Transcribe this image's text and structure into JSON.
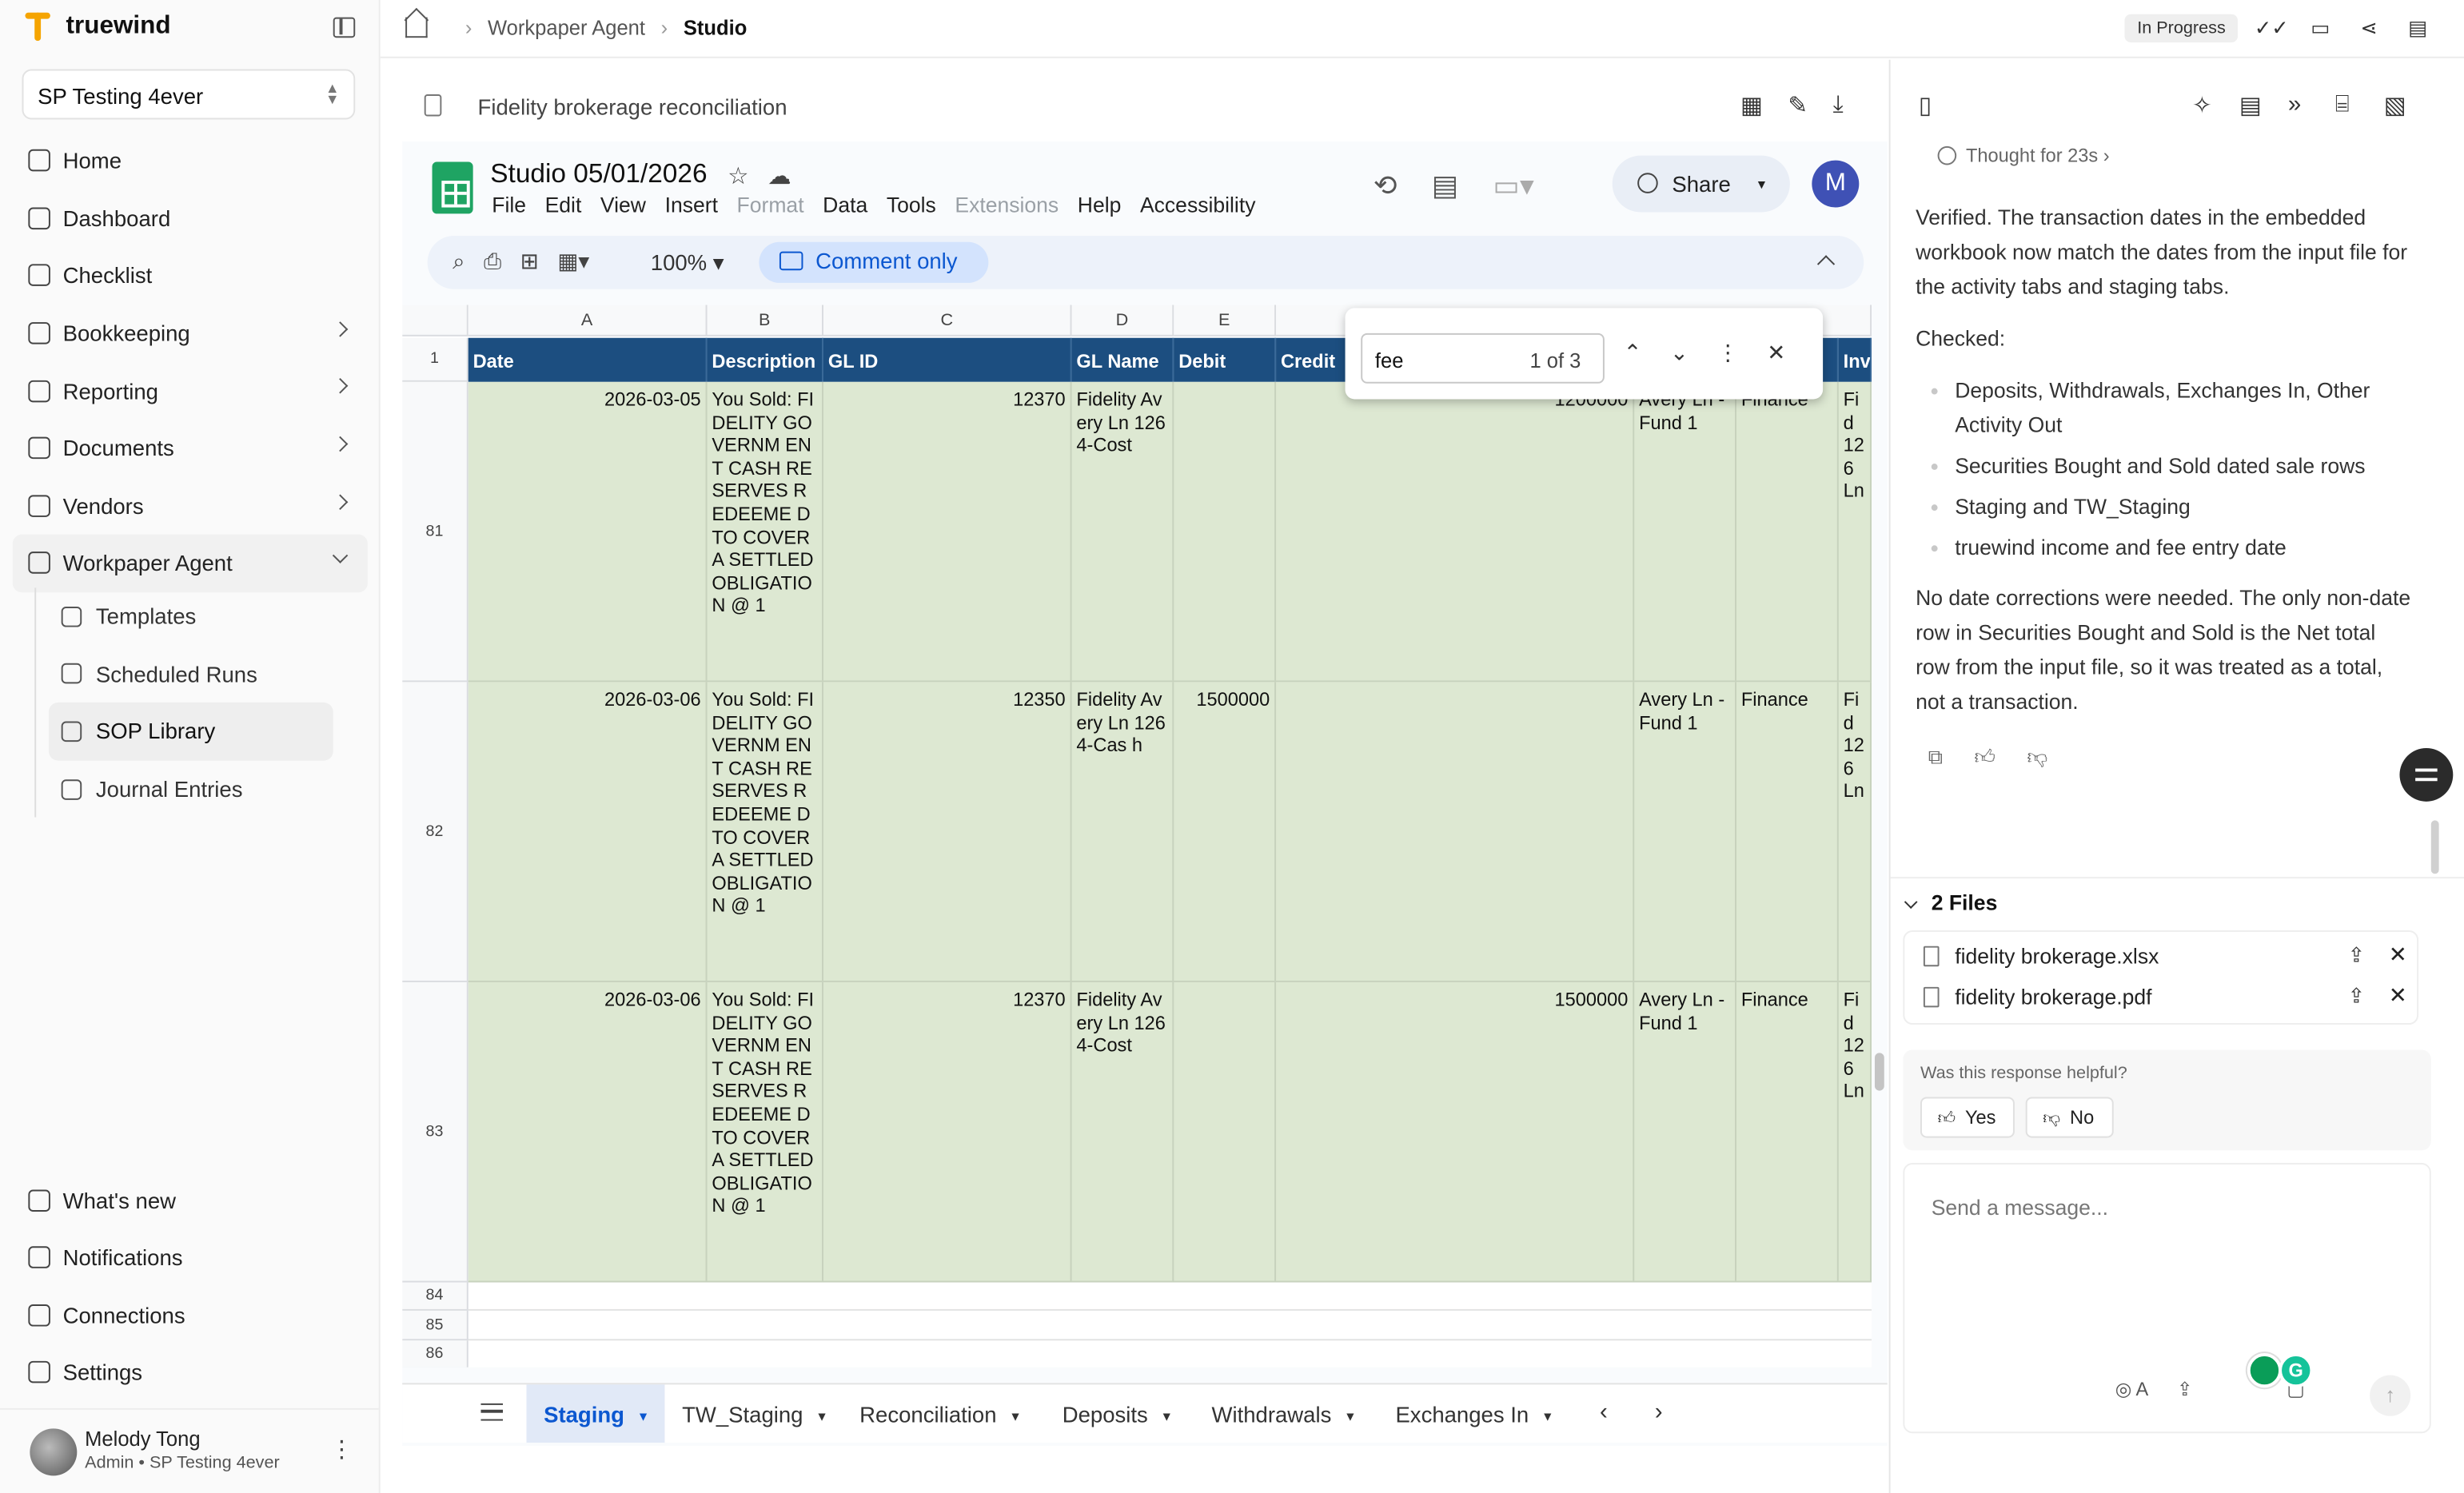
{
  "app": {
    "brand": "truewind",
    "org": "SP Testing 4ever"
  },
  "nav": {
    "items": [
      {
        "label": "Home",
        "icon": "home-icon"
      },
      {
        "label": "Dashboard",
        "icon": "dashboard-icon"
      },
      {
        "label": "Checklist",
        "icon": "calendar-icon"
      },
      {
        "label": "Bookkeeping",
        "icon": "book-icon"
      },
      {
        "label": "Reporting",
        "icon": "chart-icon"
      },
      {
        "label": "Documents",
        "icon": "copy-icon"
      },
      {
        "label": "Vendors",
        "icon": "card-icon"
      },
      {
        "label": "Workpaper Agent",
        "icon": "workflow-icon"
      }
    ],
    "sub_items": [
      {
        "label": "Templates",
        "icon": "template-icon"
      },
      {
        "label": "Scheduled Runs",
        "icon": "calendar-clock-icon"
      },
      {
        "label": "SOP Library",
        "icon": "library-icon"
      },
      {
        "label": "Journal Entries",
        "icon": "journal-icon"
      }
    ],
    "bottom": [
      {
        "label": "What's new",
        "icon": "gift-icon"
      },
      {
        "label": "Notifications",
        "icon": "bell-icon"
      },
      {
        "label": "Connections",
        "icon": "plug-icon"
      },
      {
        "label": "Settings",
        "icon": "gear-icon"
      }
    ]
  },
  "user": {
    "name": "Melody Tong",
    "role": "Admin • SP Testing 4ever"
  },
  "topbar": {
    "crumbs": [
      "Workpaper Agent",
      "Studio"
    ],
    "status": "In Progress"
  },
  "doc": {
    "title": "Fidelity brokerage reconciliation"
  },
  "sheets": {
    "title": "Studio 05/01/2026",
    "menu": [
      "File",
      "Edit",
      "View",
      "Insert",
      "Format",
      "Data",
      "Tools",
      "Extensions",
      "Help",
      "Accessibility"
    ],
    "share_label": "Share",
    "account_initial": "M",
    "zoom": "100%",
    "mode": "Comment only",
    "columns": [
      "A",
      "B",
      "C",
      "D",
      "E"
    ],
    "header_row_number": "1",
    "headers": [
      "Date",
      "Description",
      "GL ID",
      "GL Name",
      "Debit",
      "Credit"
    ],
    "rows": [
      {
        "num": "81",
        "date": "2026-03-05",
        "desc": "You Sold: FIDELITY GOVERNM ENT CASH RESERVES REDEEME D TO COVER A SETTLED OBLIGATIO N @ 1",
        "gl_id": "12370",
        "gl_name": "Fidelity Avery Ln 1264-Cost",
        "debit": "",
        "credit": "",
        "amount": "1200000",
        "fund": "Avery Ln - Fund 1",
        "dept": "Finance",
        "inv": "Fid 126 Ln"
      },
      {
        "num": "82",
        "date": "2026-03-06",
        "desc": "You Sold: FIDELITY GOVERNM ENT CASH RESERVES REDEEME D TO COVER A SETTLED OBLIGATIO N @ 1",
        "gl_id": "12350",
        "gl_name": "Fidelity Avery Ln 1264-Cas h",
        "debit": "1500000",
        "credit": "",
        "amount": "",
        "fund": "Avery Ln - Fund 1",
        "dept": "Finance",
        "inv": "Fid 126 Ln"
      },
      {
        "num": "83",
        "date": "2026-03-06",
        "desc": "You Sold: FIDELITY GOVERNM ENT CASH RESERVES REDEEME D TO COVER A SETTLED OBLIGATIO N @ 1",
        "gl_id": "12370",
        "gl_name": "Fidelity Avery Ln 1264-Cost",
        "debit": "",
        "credit": "",
        "amount": "1500000",
        "fund": "Avery Ln - Fund 1",
        "dept": "Finance",
        "inv": "Fid 126 Ln"
      }
    ],
    "empty_rows": [
      "84",
      "85",
      "86"
    ],
    "extra_header": "Inv",
    "find": {
      "query": "fee",
      "count": "1 of 3"
    },
    "tabs": [
      "Staging",
      "TW_Staging",
      "Reconciliation",
      "Deposits",
      "Withdrawals",
      "Exchanges In"
    ]
  },
  "panel": {
    "thought": "Thought for 23s",
    "message_p1": "Verified. The transaction dates in the embedded workbook now match the dates from the input file for the activity tabs and staging tabs.",
    "checked_label": "Checked:",
    "checked_items": [
      "Deposits, Withdrawals, Exchanges In, Other Activity Out",
      "Securities Bought and Sold dated sale rows",
      "Staging and TW_Staging",
      "truewind income and fee entry date"
    ],
    "message_p2": "No date corrections were needed. The only non-date row in Securities Bought and Sold is the Net total row from the input file, so it was treated as a total, not a transaction.",
    "files_label": "2 Files",
    "files": [
      "fidelity brokerage.xlsx",
      "fidelity brokerage.pdf"
    ],
    "helpful_q": "Was this response helpful?",
    "yes": "Yes",
    "no": "No",
    "compose_placeholder": "Send a message...",
    "model_label": "A"
  }
}
